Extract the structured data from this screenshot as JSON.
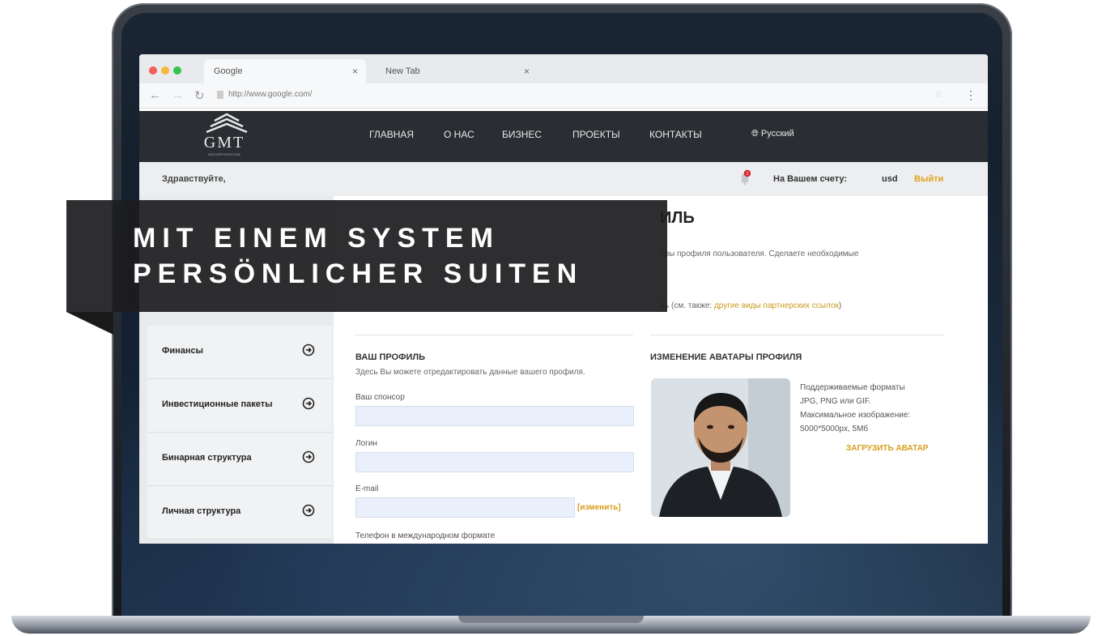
{
  "browser": {
    "tabs": [
      {
        "label": "Google",
        "close": "×"
      },
      {
        "label": "New Tab",
        "close": "×"
      }
    ],
    "url": "http://www.google.com/",
    "traffic_colors": [
      "#f25d56",
      "#f5b83a",
      "#35c24f"
    ]
  },
  "site": {
    "logo_text": "GMT",
    "logo_sub": "INCORPORATION",
    "menu": [
      "ГЛАВНАЯ",
      "О НАС",
      "БИЗНЕС",
      "ПРОЕКТЫ",
      "КОНТАКТЫ"
    ],
    "language": "Русский",
    "greeting": "Здравствуйте,",
    "notification_count": "2",
    "account_label": "На Вашем счету:",
    "currency": "usd",
    "logout": "Выйти"
  },
  "sidebar": {
    "items": [
      {
        "label": "Финансы"
      },
      {
        "label": "Инвестиционные пакеты"
      },
      {
        "label": "Бинарная структура"
      },
      {
        "label": "Личная структура"
      }
    ]
  },
  "content": {
    "page_heading": "ИЛЬ",
    "page_desc": "тры профиля пользователя. Сделаете необходимые",
    "ref_prefix": "сь (см. также: ",
    "ref_link": "другие виды партнерских ссылок",
    "ref_suffix": ")",
    "profile": {
      "title": "ВАШ ПРОФИЛЬ",
      "subtitle": "Здесь Вы можете отредактировать данные вашего профиля.",
      "sponsor_label": "Ваш спонсор",
      "login_label": "Логин",
      "email_label": "E-mail",
      "change_link": "[изменить]",
      "phone_label": "Телефон в международном формате"
    },
    "avatar": {
      "title": "ИЗМЕНЕНИЕ АВАТАРЫ ПРОФИЛЯ",
      "info_lines": [
        "Поддерживаемые форматы",
        "JPG, PNG или GIF.",
        "Максимальное изображение:",
        "5000*5000px, 5Мб"
      ],
      "upload_button": "ЗАГРУЗИТЬ АВАТАР"
    }
  },
  "overlay": {
    "line1": "MIT EINEM SYSTEM",
    "line2": "PERSÖNLICHER SUITEN"
  },
  "colors": {
    "accent": "#d99c1f",
    "nav_bg": "#2a2d32"
  }
}
